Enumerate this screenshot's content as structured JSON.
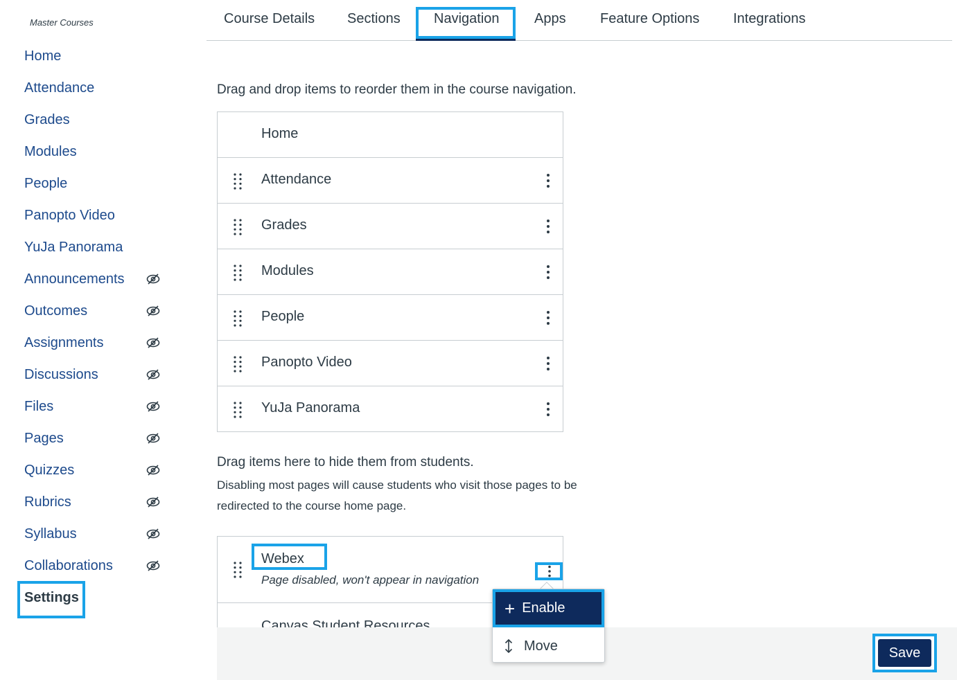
{
  "course_label": "Master Courses",
  "sidebar": {
    "items": [
      {
        "label": "Home"
      },
      {
        "label": "Attendance"
      },
      {
        "label": "Grades"
      },
      {
        "label": "Modules"
      },
      {
        "label": "People"
      },
      {
        "label": "Panopto Video"
      },
      {
        "label": "YuJa Panorama"
      },
      {
        "label": "Announcements",
        "icon": "eye-slash-icon"
      },
      {
        "label": "Outcomes",
        "icon": "eye-slash-icon"
      },
      {
        "label": "Assignments",
        "icon": "eye-slash-icon"
      },
      {
        "label": "Discussions",
        "icon": "eye-slash-icon"
      },
      {
        "label": "Files",
        "icon": "eye-slash-icon"
      },
      {
        "label": "Pages",
        "icon": "eye-slash-icon"
      },
      {
        "label": "Quizzes",
        "icon": "eye-slash-icon"
      },
      {
        "label": "Rubrics",
        "icon": "eye-slash-icon"
      },
      {
        "label": "Syllabus",
        "icon": "eye-slash-icon"
      },
      {
        "label": "Collaborations",
        "icon": "eye-slash-icon"
      },
      {
        "label": "Settings",
        "active": true
      }
    ]
  },
  "tabs": [
    {
      "label": "Course Details"
    },
    {
      "label": "Sections"
    },
    {
      "label": "Navigation",
      "active": true
    },
    {
      "label": "Apps"
    },
    {
      "label": "Feature Options"
    },
    {
      "label": "Integrations"
    }
  ],
  "navigation": {
    "instructions": "Drag and drop items to reorder them in the course navigation.",
    "enabled_items": [
      {
        "label": "Home"
      },
      {
        "label": "Attendance"
      },
      {
        "label": "Grades"
      },
      {
        "label": "Modules"
      },
      {
        "label": "People"
      },
      {
        "label": "Panopto Video"
      },
      {
        "label": "YuJa Panorama"
      }
    ],
    "hidden_title": "Drag items here to hide them from students.",
    "hidden_note": "Disabling most pages will cause students who visit those pages to be redirected to the course home page.",
    "hidden_items": [
      {
        "label": "Webex",
        "status": "Page disabled, won't appear in navigation"
      },
      {
        "label": "Canvas Student Resources"
      }
    ]
  },
  "menu": {
    "enable_label": "Enable",
    "move_label": "Move"
  },
  "save_label": "Save",
  "colors": {
    "link": "#1d4a8c",
    "primary": "#0e2a5c",
    "highlight": "#1aa3e8",
    "text": "#2d3b45",
    "border": "#c7cdd1",
    "footer": "#f3f4f4"
  }
}
